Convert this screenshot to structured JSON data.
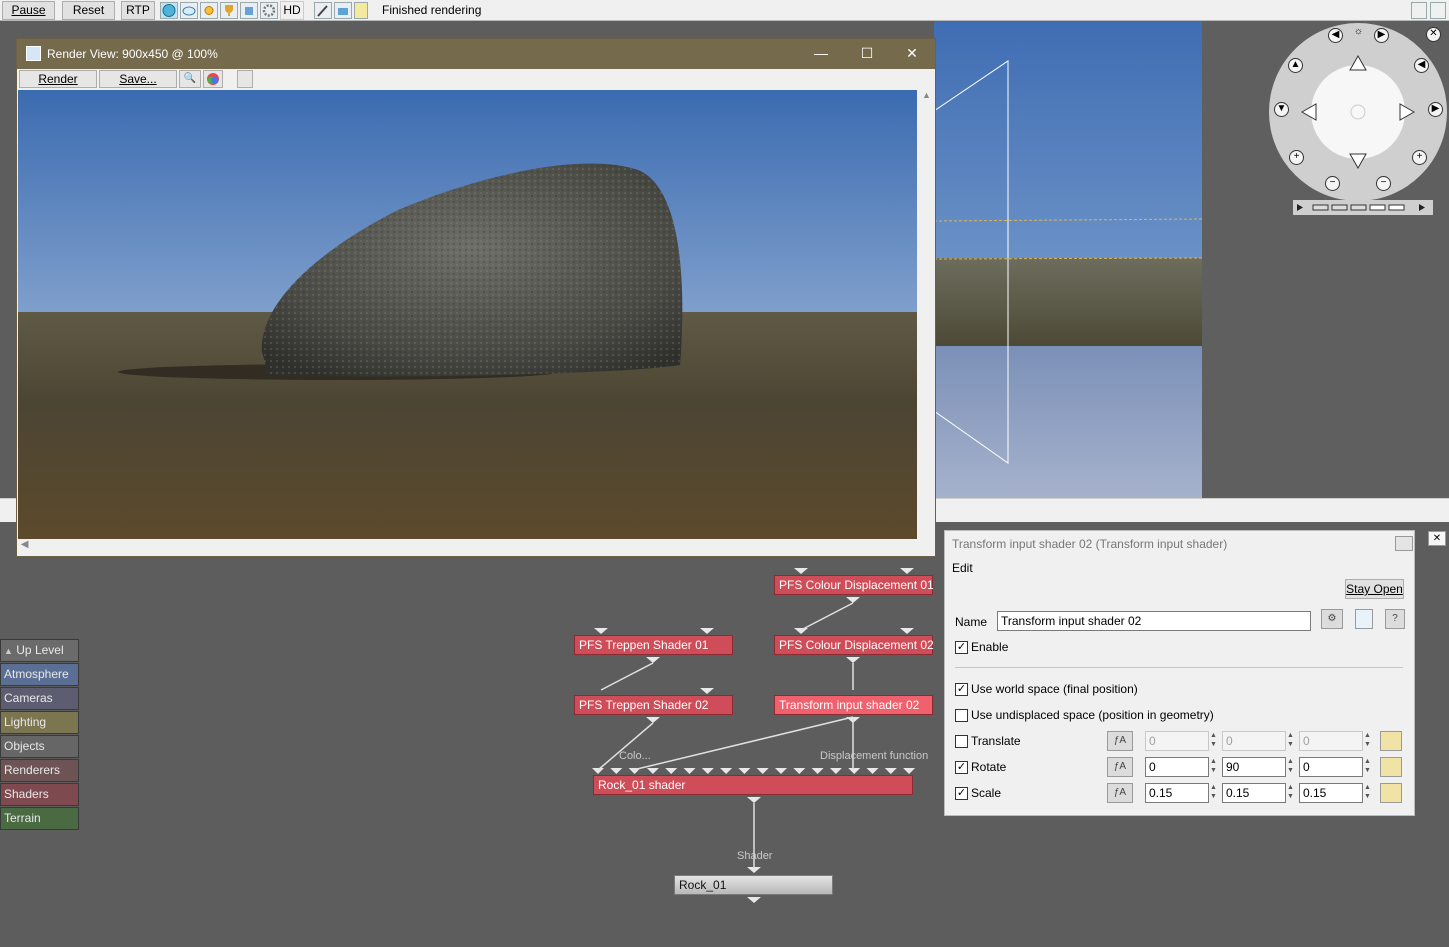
{
  "toolbar": {
    "pause_label": "Pause",
    "reset_label": "Reset",
    "rtp_label": "RTP",
    "hd_label": "HD",
    "status_text": "Finished rendering",
    "icons": [
      "globe-icon",
      "cloud-icon",
      "sun-icon",
      "trophy-icon",
      "bucket-icon",
      "gear-icon"
    ]
  },
  "render_view": {
    "title": "Render View: 900x450 @ 100%",
    "render_label": "Render",
    "save_label": "Save...",
    "minimize_glyph": "—",
    "maximize_glyph": "☐",
    "close_glyph": "✕"
  },
  "sidebar": {
    "items": [
      {
        "label": "Up Level",
        "color": "#6b6b6b"
      },
      {
        "label": "Atmosphere",
        "color": "#5b6e93"
      },
      {
        "label": "Cameras",
        "color": "#5c5d71"
      },
      {
        "label": "Lighting",
        "color": "#7b7650"
      },
      {
        "label": "Objects",
        "color": "#666666"
      },
      {
        "label": "Renderers",
        "color": "#6d5353"
      },
      {
        "label": "Shaders",
        "color": "#7e4a4f"
      },
      {
        "label": "Terrain",
        "color": "#4a6b42"
      }
    ],
    "up_glyph": "▲"
  },
  "graph": {
    "nodes": {
      "colour_disp_01": "PFS Colour Displacement 01",
      "colour_disp_02": "PFS Colour Displacement 02",
      "treppen_01": "PFS Treppen Shader 01",
      "treppen_02": "PFS Treppen Shader 02",
      "transform_02": "Transform input shader 02",
      "rock_shader": "Rock_01 shader",
      "rock_obj": "Rock_01"
    },
    "labels": {
      "colo": "Colo...",
      "displacement": "Displacement function",
      "shader": "Shader"
    }
  },
  "props": {
    "header": "Transform input shader 02    (Transform input shader)",
    "edit_label": "Edit",
    "stay_open_label": "Stay Open",
    "name_label": "Name",
    "name_value": "Transform input shader 02",
    "help_glyph": "?",
    "enable_label": "Enable",
    "enable_checked": true,
    "world_space_label": "Use world space (final position)",
    "world_space_checked": true,
    "undisplaced_label": "Use undisplaced space (position in geometry)",
    "undisplaced_checked": false,
    "rows": [
      {
        "label": "Translate",
        "checked": false,
        "values": [
          "0",
          "0",
          "0"
        ],
        "disabled": true
      },
      {
        "label": "Rotate",
        "checked": true,
        "values": [
          "0",
          "90",
          "0"
        ],
        "disabled": false
      },
      {
        "label": "Scale",
        "checked": true,
        "values": [
          "0.15",
          "0.15",
          "0.15"
        ],
        "disabled": false
      }
    ],
    "check_glyph": "✓"
  }
}
